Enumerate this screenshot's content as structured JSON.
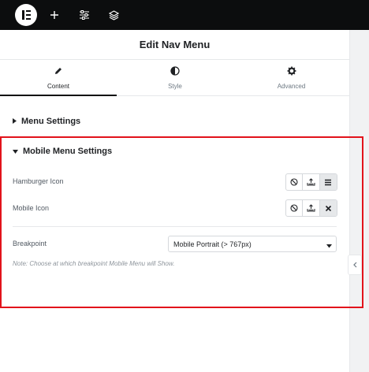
{
  "panel": {
    "title": "Edit Nav Menu"
  },
  "tabs": [
    {
      "label": "Content",
      "icon": "pencil-icon",
      "active": true
    },
    {
      "label": "Style",
      "icon": "half-circle-icon",
      "active": false
    },
    {
      "label": "Advanced",
      "icon": "gear-icon",
      "active": false
    }
  ],
  "sections": {
    "menu_settings": {
      "title": "Menu Settings",
      "expanded": false
    },
    "mobile_menu_settings": {
      "title": "Mobile Menu Settings",
      "expanded": true
    }
  },
  "controls": {
    "hamburger_icon": {
      "label": "Hamburger Icon",
      "options": [
        "none-icon",
        "upload-icon",
        "hamburger-icon"
      ],
      "selected": "hamburger-icon"
    },
    "mobile_icon": {
      "label": "Mobile Icon",
      "options": [
        "none-icon",
        "upload-icon",
        "close-icon"
      ],
      "selected": "close-icon"
    },
    "breakpoint": {
      "label": "Breakpoint",
      "value": "Mobile Portrait (> 767px)",
      "note": "Note: Choose at which breakpoint Mobile Menu will Show."
    }
  },
  "colors": {
    "topbar": "#0c0d0e",
    "highlight_border": "#e2131b",
    "text_dark": "#1f2124",
    "text_muted": "#6d7882",
    "note": "#8e959c"
  }
}
